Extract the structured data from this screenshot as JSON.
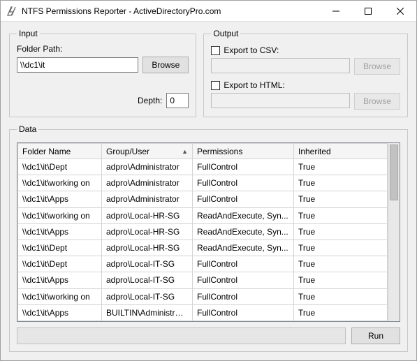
{
  "window": {
    "title": "NTFS Permissions Reporter - ActiveDirectoryPro.com"
  },
  "input": {
    "legend": "Input",
    "folder_path_label": "Folder Path:",
    "folder_path_value": "\\\\dc1\\it",
    "browse_label": "Browse",
    "depth_label": "Depth:",
    "depth_value": "0"
  },
  "output": {
    "legend": "Output",
    "export_csv_label": "Export to CSV:",
    "export_csv_checked": false,
    "csv_path": "",
    "csv_browse_label": "Browse",
    "export_html_label": "Export to HTML:",
    "export_html_checked": false,
    "html_path": "",
    "html_browse_label": "Browse"
  },
  "data": {
    "legend": "Data",
    "columns": {
      "folder": "Folder Name",
      "group": "Group/User",
      "perm": "Permissions",
      "inh": "Inherited"
    },
    "sort_column": "group",
    "rows": [
      {
        "folder": "\\\\dc1\\it\\Dept",
        "group": "adpro\\Administrator",
        "perm": "FullControl",
        "inh": "True"
      },
      {
        "folder": "\\\\dc1\\it\\working on",
        "group": "adpro\\Administrator",
        "perm": "FullControl",
        "inh": "True"
      },
      {
        "folder": "\\\\dc1\\it\\Apps",
        "group": "adpro\\Administrator",
        "perm": "FullControl",
        "inh": "True"
      },
      {
        "folder": "\\\\dc1\\it\\working on",
        "group": "adpro\\Local-HR-SG",
        "perm": "ReadAndExecute, Syn...",
        "inh": "True"
      },
      {
        "folder": "\\\\dc1\\it\\Apps",
        "group": "adpro\\Local-HR-SG",
        "perm": "ReadAndExecute, Syn...",
        "inh": "True"
      },
      {
        "folder": "\\\\dc1\\it\\Dept",
        "group": "adpro\\Local-HR-SG",
        "perm": "ReadAndExecute, Syn...",
        "inh": "True"
      },
      {
        "folder": "\\\\dc1\\it\\Dept",
        "group": "adpro\\Local-IT-SG",
        "perm": "FullControl",
        "inh": "True"
      },
      {
        "folder": "\\\\dc1\\it\\Apps",
        "group": "adpro\\Local-IT-SG",
        "perm": "FullControl",
        "inh": "True"
      },
      {
        "folder": "\\\\dc1\\it\\working on",
        "group": "adpro\\Local-IT-SG",
        "perm": "FullControl",
        "inh": "True"
      },
      {
        "folder": "\\\\dc1\\it\\Apps",
        "group": "BUILTIN\\Administrators",
        "perm": "FullControl",
        "inh": "True"
      }
    ]
  },
  "footer": {
    "run_label": "Run"
  }
}
